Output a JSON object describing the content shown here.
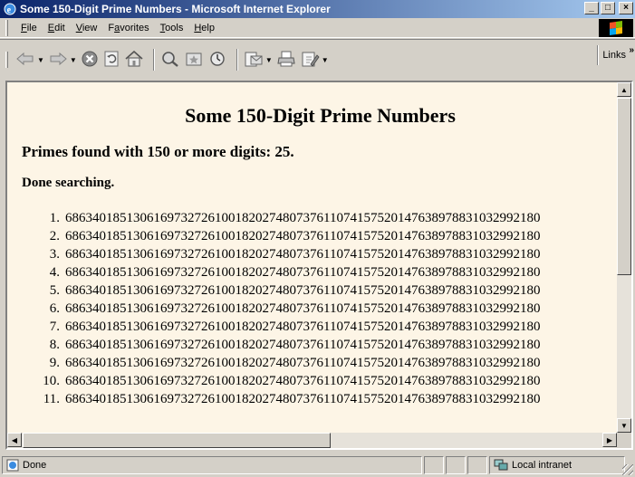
{
  "window": {
    "title": "Some 150-Digit Prime Numbers - Microsoft Internet Explorer",
    "minimize": "_",
    "maximize": "□",
    "close": "×"
  },
  "menu": {
    "file": "File",
    "edit": "Edit",
    "view": "View",
    "favorites": "Favorites",
    "tools": "Tools",
    "help": "Help"
  },
  "toolbar": {
    "links_label": "Links",
    "links_chevron": "»",
    "buttons": [
      "back-icon",
      "forward-icon",
      "stop-icon",
      "refresh-icon",
      "home-icon",
      "search-icon",
      "favorites-icon",
      "history-icon",
      "mail-icon",
      "print-icon",
      "edit-icon"
    ]
  },
  "page": {
    "heading": "Some 150-Digit Prime Numbers",
    "found_text": "Primes found with 150 or more digits: 25.",
    "done_text": "Done searching.",
    "primes": [
      {
        "n": "1.",
        "value": "6863401851306169732726100182027480737611074157520147638978831032992180"
      },
      {
        "n": "2.",
        "value": "6863401851306169732726100182027480737611074157520147638978831032992180"
      },
      {
        "n": "3.",
        "value": "6863401851306169732726100182027480737611074157520147638978831032992180"
      },
      {
        "n": "4.",
        "value": "6863401851306169732726100182027480737611074157520147638978831032992180"
      },
      {
        "n": "5.",
        "value": "6863401851306169732726100182027480737611074157520147638978831032992180"
      },
      {
        "n": "6.",
        "value": "6863401851306169732726100182027480737611074157520147638978831032992180"
      },
      {
        "n": "7.",
        "value": "6863401851306169732726100182027480737611074157520147638978831032992180"
      },
      {
        "n": "8.",
        "value": "6863401851306169732726100182027480737611074157520147638978831032992180"
      },
      {
        "n": "9.",
        "value": "6863401851306169732726100182027480737611074157520147638978831032992180"
      },
      {
        "n": "10.",
        "value": "6863401851306169732726100182027480737611074157520147638978831032992180"
      },
      {
        "n": "11.",
        "value": "6863401851306169732726100182027480737611074157520147638978831032992180"
      }
    ]
  },
  "statusbar": {
    "status": "Done",
    "zone": "Local intranet"
  },
  "colors": {
    "page_background": "#fdf5e6",
    "title_bar": "#0a246a"
  }
}
